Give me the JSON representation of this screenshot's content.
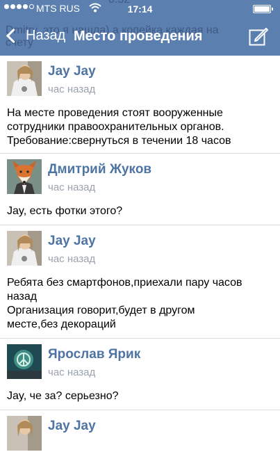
{
  "status_bar": {
    "carrier": "MTS RUS",
    "time": "17:14"
  },
  "header_ghost": {
    "line1": "0:32",
    "line2": "Dmitry, это я нашла) а копейка каждая на",
    "line3": "счету"
  },
  "nav": {
    "back_label": "Назад",
    "title": "Место проведения"
  },
  "posts": [
    {
      "author": "Jay Jay",
      "time": "час назад",
      "lines": [
        "На месте проведения стоят вооруженные",
        "сотрудники правоохранительных органов.",
        "Требование:свернуться в течении 18 часов"
      ]
    },
    {
      "author": "Дмитрий Жуков",
      "time": "час назад",
      "lines": [
        "Jay, есть фотки этого?"
      ]
    },
    {
      "author": "Jay Jay",
      "time": "час назад",
      "lines": [
        "Ребята без смартфонов,приехали пару часов",
        "назад",
        "Организация говорит,будет в другом",
        "месте,без декораций"
      ]
    },
    {
      "author": "Ярослав Ярик",
      "time": "час назад",
      "lines": [
        "Jay, че за? серьезно?"
      ]
    },
    {
      "author": "Jay Jay",
      "time": "",
      "lines": []
    }
  ]
}
